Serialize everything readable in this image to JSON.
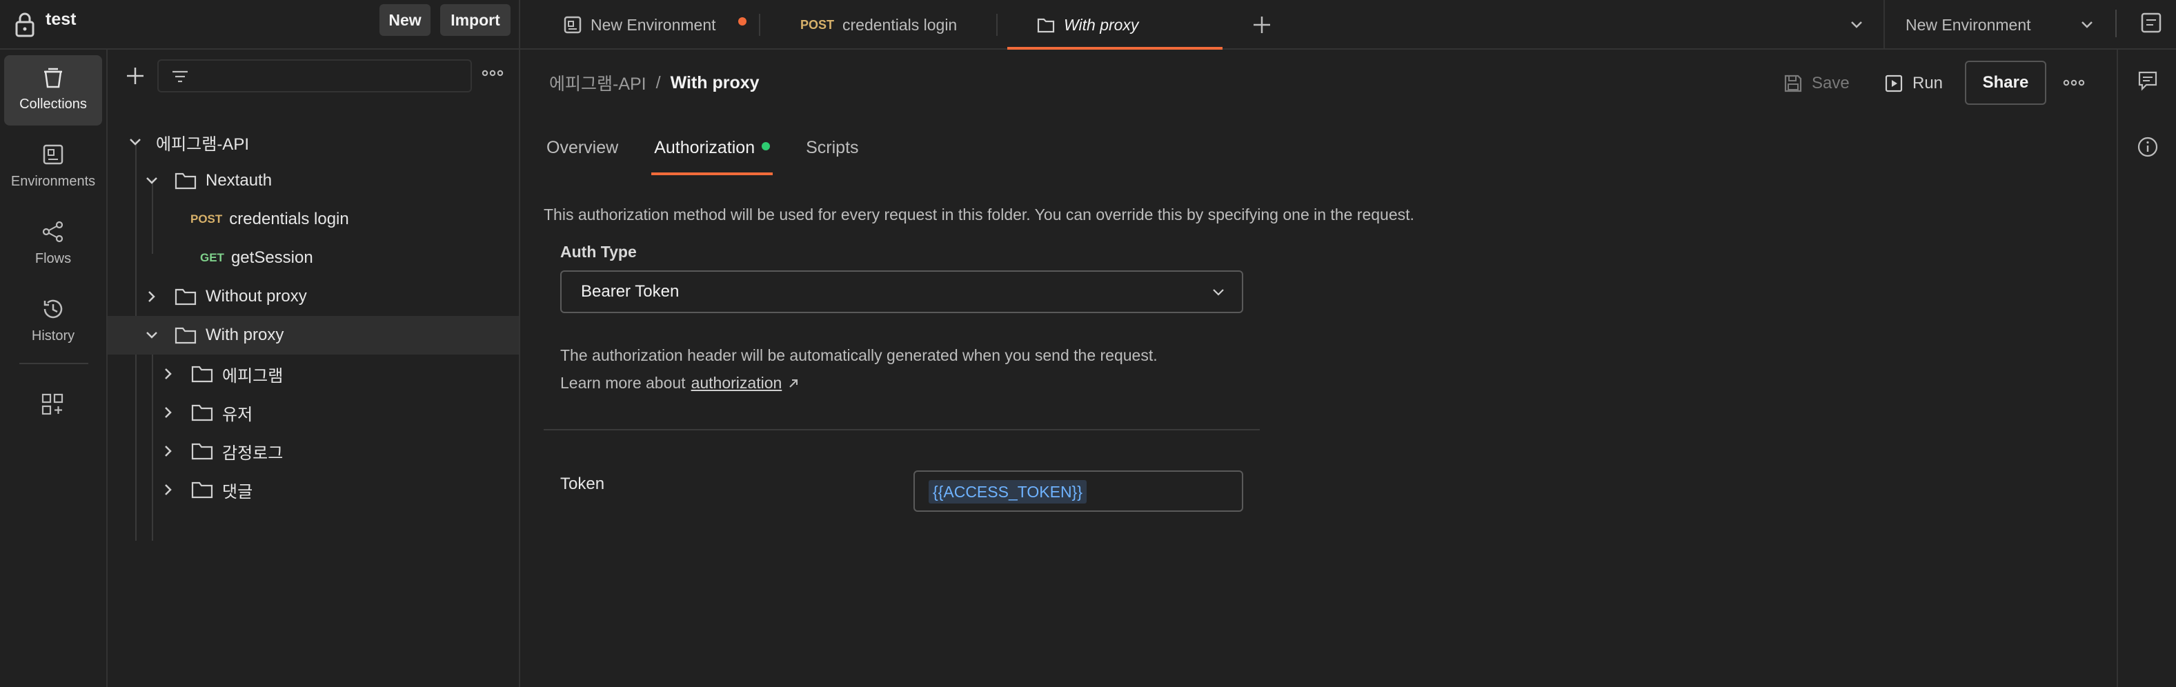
{
  "workspace": {
    "name": "test",
    "new_label": "New",
    "import_label": "Import"
  },
  "tabs": [
    {
      "label": "New Environment",
      "unsaved": true
    },
    {
      "method": "POST",
      "label": "credentials login"
    },
    {
      "label": "With proxy",
      "active": true
    }
  ],
  "environment_selector": {
    "value": "New Environment"
  },
  "rail": {
    "items": [
      {
        "label": "Collections",
        "active": true
      },
      {
        "label": "Environments"
      },
      {
        "label": "Flows"
      },
      {
        "label": "History"
      }
    ]
  },
  "tree": {
    "root": "에피그램-API",
    "nextauth": "Nextauth",
    "credentials": {
      "method": "POST",
      "label": "credentials login"
    },
    "getsession": {
      "method": "GET",
      "label": "getSession"
    },
    "without_proxy": "Without proxy",
    "with_proxy": "With proxy",
    "sub": [
      "에피그램",
      "유저",
      "감정로그",
      "댓글"
    ]
  },
  "breadcrumb": {
    "parent": "에피그램-API",
    "sep": "/",
    "current": "With proxy"
  },
  "actions": {
    "save": "Save",
    "run": "Run",
    "share": "Share"
  },
  "subtabs": {
    "overview": "Overview",
    "authorization": "Authorization",
    "scripts": "Scripts"
  },
  "auth": {
    "description": "This authorization method will be used for every request in this folder. You can override this by specifying one in the request.",
    "type_label": "Auth Type",
    "type_value": "Bearer Token",
    "info_line1": "The authorization header will be automatically generated when you send the request.",
    "info_line2_prefix": "Learn more about",
    "info_link": "authorization",
    "token_label": "Token",
    "token_value": "{{ACCESS_TOKEN}}"
  },
  "colors": {
    "accent": "#f26b3a",
    "status_dot": "#2ecc71",
    "post": "#d7b16a",
    "get": "#7fd08b",
    "variable": "#6fb3ff"
  }
}
